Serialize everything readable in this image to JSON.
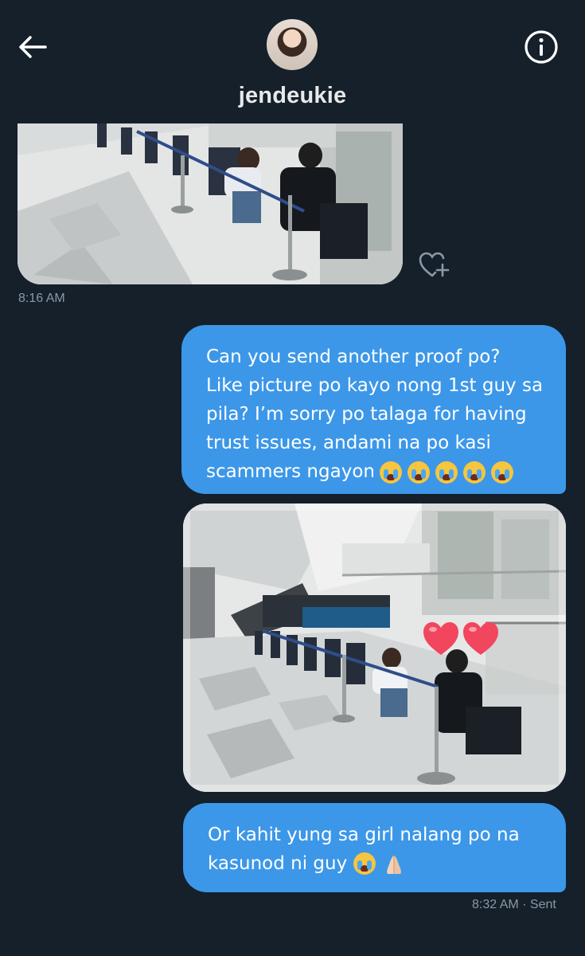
{
  "header": {
    "username": "jendeukie",
    "back_icon": "arrow-left-icon",
    "info_icon": "info-circle-icon",
    "avatar": "profile-avatar"
  },
  "messages": [
    {
      "direction": "received",
      "type": "image",
      "description_icon": "mall-queue-photo",
      "timestamp": "8:16 AM"
    },
    {
      "direction": "sent",
      "type": "text",
      "lines": [
        "Can you send another proof po?",
        "Like picture po kayo nong 1st guy sa",
        "pila? I’m sorry po talaga for having",
        "trust issues, andami na po kasi",
        "scammers ngayon"
      ],
      "emoji_count": 5
    },
    {
      "direction": "sent",
      "type": "image",
      "description_icon": "mall-queue-photo-with-hearts"
    },
    {
      "direction": "sent",
      "type": "text",
      "lines": [
        "Or kahit yung sa girl nalang po na",
        "kasunod ni guy"
      ],
      "emoji": [
        "loudly-crying-face",
        "folded-hands"
      ]
    }
  ],
  "status": {
    "time": "8:32 AM",
    "separator": " · ",
    "label": "Sent"
  },
  "react_icon": "heart-plus-icon",
  "colors": {
    "background": "#15202b",
    "sent_bubble": "#3c97e8",
    "muted_text": "#8b98a5"
  }
}
